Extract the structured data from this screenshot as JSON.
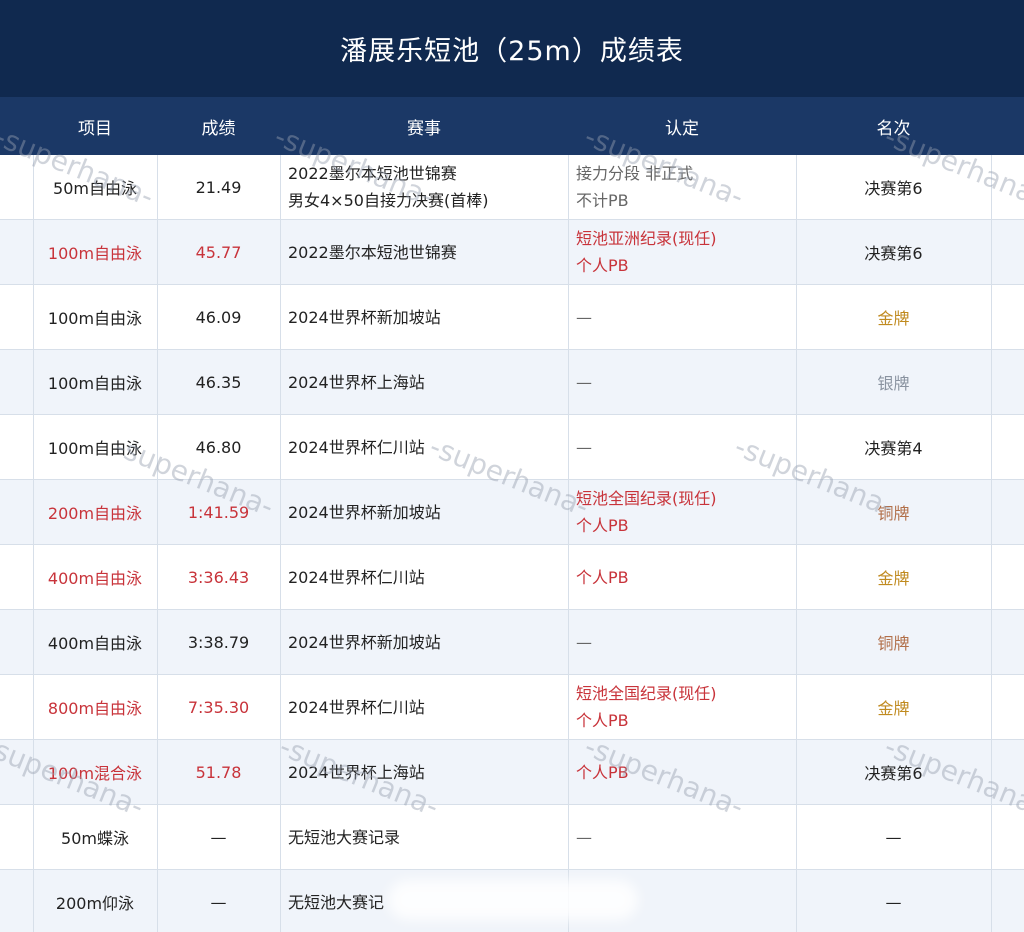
{
  "title": "潘展乐短池（25m）成绩表",
  "headers": {
    "event": "项目",
    "result": "成绩",
    "competition": "赛事",
    "recognition": "认定",
    "rank": "名次"
  },
  "rows": [
    {
      "event": "50m自由泳",
      "result": "21.49",
      "competition_1": "2022墨尔本短池世锦赛",
      "competition_2": "男女4×50自接力决赛(首棒)",
      "recognition_1": "接力分段 非正式",
      "recognition_2": "不计PB",
      "rank": "决赛第6"
    },
    {
      "event": "100m自由泳",
      "result": "45.77",
      "competition_1": "2022墨尔本短池世锦赛",
      "competition_2": "",
      "recognition_1": "短池亚洲纪录(现任)",
      "recognition_2": "个人PB",
      "rank": "决赛第6"
    },
    {
      "event": "100m自由泳",
      "result": "46.09",
      "competition_1": "2024世界杯新加坡站",
      "competition_2": "",
      "recognition_1": "—",
      "recognition_2": "",
      "rank": "金牌"
    },
    {
      "event": "100m自由泳",
      "result": "46.35",
      "competition_1": "2024世界杯上海站",
      "competition_2": "",
      "recognition_1": "—",
      "recognition_2": "",
      "rank": "银牌"
    },
    {
      "event": "100m自由泳",
      "result": "46.80",
      "competition_1": "2024世界杯仁川站",
      "competition_2": "",
      "recognition_1": "—",
      "recognition_2": "",
      "rank": "决赛第4"
    },
    {
      "event": "200m自由泳",
      "result": "1:41.59",
      "competition_1": "2024世界杯新加坡站",
      "competition_2": "",
      "recognition_1": "短池全国纪录(现任)",
      "recognition_2": "个人PB",
      "rank": "铜牌"
    },
    {
      "event": "400m自由泳",
      "result": "3:36.43",
      "competition_1": "2024世界杯仁川站",
      "competition_2": "",
      "recognition_1": "个人PB",
      "recognition_2": "",
      "rank": "金牌"
    },
    {
      "event": "400m自由泳",
      "result": "3:38.79",
      "competition_1": "2024世界杯新加坡站",
      "competition_2": "",
      "recognition_1": "—",
      "recognition_2": "",
      "rank": "铜牌"
    },
    {
      "event": "800m自由泳",
      "result": "7:35.30",
      "competition_1": "2024世界杯仁川站",
      "competition_2": "",
      "recognition_1": "短池全国纪录(现任)",
      "recognition_2": "个人PB",
      "rank": "金牌"
    },
    {
      "event": "100m混合泳",
      "result": "51.78",
      "competition_1": "2024世界杯上海站",
      "competition_2": "",
      "recognition_1": "个人PB",
      "recognition_2": "",
      "rank": "决赛第6"
    },
    {
      "event": "50m蝶泳",
      "result": "—",
      "competition_1": "无短池大赛记录",
      "competition_2": "",
      "recognition_1": "—",
      "recognition_2": "",
      "rank": "—"
    },
    {
      "event": "200m仰泳",
      "result": "—",
      "competition_1": "无短池大赛记",
      "competition_2": "",
      "recognition_1": "",
      "recognition_2": "",
      "rank": "—"
    }
  ],
  "watermark": "-superhana-",
  "colors": {
    "title_bg": "#10294f",
    "header_bg": "#1b3866",
    "highlight_red": "#c8333a",
    "gold": "#c08a1e",
    "silver": "#8a93a0",
    "bronze": "#b2704a",
    "alt_row": "#f0f4fa"
  }
}
